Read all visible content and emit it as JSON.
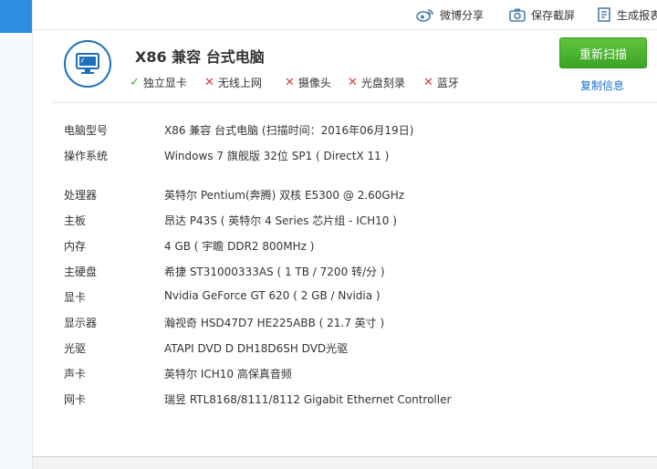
{
  "toolbar": {
    "weibo_share": "微博分享",
    "save_screenshot": "保存截屏",
    "generate_report": "生成报表"
  },
  "summary": {
    "title": "X86 兼容 台式电脑",
    "features": [
      {
        "label": "独立显卡",
        "status": "ok"
      },
      {
        "label": "无线上网",
        "status": "no"
      },
      {
        "label": "摄像头",
        "status": "no"
      },
      {
        "label": "光盘刻录",
        "status": "no"
      },
      {
        "label": "蓝牙",
        "status": "no"
      }
    ],
    "rescan_label": "重新扫描",
    "copy_label": "复制信息"
  },
  "info": [
    {
      "key": "电脑型号",
      "value": "X86 兼容 台式电脑  (扫描时间：2016年06月19日)"
    },
    {
      "key": "操作系统",
      "value": "Windows 7 旗舰版 32位 SP1 ( DirectX 11 )"
    },
    {
      "key": "处理器",
      "value": "英特尔 Pentium(奔腾) 双核 E5300 @ 2.60GHz"
    },
    {
      "key": "主板",
      "value": "昂达 P43S ( 英特尔 4 Series 芯片组 - ICH10 )"
    },
    {
      "key": "内存",
      "value": "4 GB ( 宇瞻 DDR2 800MHz )"
    },
    {
      "key": "主硬盘",
      "value": "希捷 ST31000333AS ( 1 TB / 7200 转/分 )"
    },
    {
      "key": "显卡",
      "value": "Nvidia GeForce GT 620 ( 2 GB / Nvidia )"
    },
    {
      "key": "显示器",
      "value": "瀚视奇 HSD47D7 HE225ABB ( 21.7 英寸  )"
    },
    {
      "key": "光驱",
      "value": "ATAPI DVD D DH18D6SH DVD光驱"
    },
    {
      "key": "声卡",
      "value": "英特尔 ICH10  高保真音频"
    },
    {
      "key": "网卡",
      "value": "瑞昱 RTL8168/8111/8112 Gigabit Ethernet Controller"
    }
  ],
  "colors": {
    "accent_blue": "#2b8ee0",
    "ok_green": "#3da32b",
    "no_red": "#d93b3b",
    "button_green": "#4cb530",
    "link_blue": "#1a6fc9"
  }
}
